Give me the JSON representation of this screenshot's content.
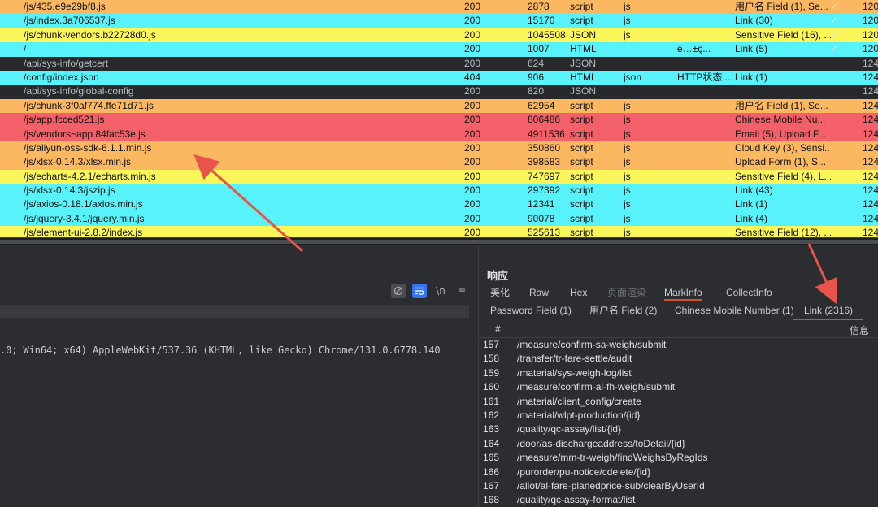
{
  "colors": {
    "orange": "#fbb860",
    "cyan": "#58f2fa",
    "yellow": "#fbf65a",
    "dark": "#27292c",
    "red": "#f46069",
    "accent": "#d0542b",
    "arrow": "#e8534a"
  },
  "traffic": {
    "rows": [
      {
        "color": "orange",
        "path": "/js/435.e9e29bf8.js",
        "status": "200",
        "size": "2878",
        "type": "script",
        "ext": "js",
        "title": "",
        "info": "用户名 Field (1), Se...",
        "check": "✓",
        "time": "120."
      },
      {
        "color": "cyan",
        "path": "/js/index.3a706537.js",
        "status": "200",
        "size": "15170",
        "type": "script",
        "ext": "js",
        "title": "",
        "info": "Link (30)",
        "check": "✓",
        "time": "120."
      },
      {
        "color": "yellow",
        "path": "/js/chunk-vendors.b22728d0.js",
        "status": "200",
        "size": "1045508",
        "type": "JSON",
        "ext": "js",
        "title": "",
        "info": "Sensitive Field (16), ...",
        "check": "✓",
        "time": "120."
      },
      {
        "color": "cyan",
        "path": "/",
        "status": "200",
        "size": "1007",
        "type": "HTML",
        "ext": "",
        "title": "é…±ç...",
        "info": "Link (5)",
        "check": "✓",
        "time": "120."
      },
      {
        "color": "dark",
        "path": "/api/sys-info/getcert",
        "status": "200",
        "size": "624",
        "type": "JSON",
        "ext": "",
        "title": "",
        "info": "",
        "check": "",
        "time": "124."
      },
      {
        "color": "cyan",
        "path": "/config/index.json",
        "status": "404",
        "size": "906",
        "type": "HTML",
        "ext": "json",
        "title": "HTTP状态 ...",
        "info": "Link (1)",
        "check": "",
        "time": "124."
      },
      {
        "color": "dark",
        "path": "/api/sys-info/global-config",
        "status": "200",
        "size": "820",
        "type": "JSON",
        "ext": "",
        "title": "",
        "info": "",
        "check": "",
        "time": "124."
      },
      {
        "color": "orange",
        "path": "/js/chunk-3f0af774.ffe71d71.js",
        "status": "200",
        "size": "62954",
        "type": "script",
        "ext": "js",
        "title": "",
        "info": "用户名 Field (1), Se...",
        "check": "",
        "time": "124."
      },
      {
        "color": "red",
        "path": "/js/app.fcced521.js",
        "status": "200",
        "size": "806486",
        "type": "script",
        "ext": "js",
        "title": "",
        "info": "Chinese Mobile Nu...",
        "check": "",
        "time": "124."
      },
      {
        "color": "red",
        "path": "/js/vendors~app.84fac53e.js",
        "status": "200",
        "size": "4911536",
        "type": "script",
        "ext": "js",
        "title": "",
        "info": "Email (5), Upload F...",
        "check": "",
        "time": "124."
      },
      {
        "color": "orange",
        "path": "/js/aliyun-oss-sdk-6.1.1.min.js",
        "status": "200",
        "size": "350860",
        "type": "script",
        "ext": "js",
        "title": "",
        "info": "Cloud Key (3), Sensi...",
        "check": "",
        "time": "124."
      },
      {
        "color": "orange",
        "path": "/js/xlsx-0.14.3/xlsx.min.js",
        "status": "200",
        "size": "398583",
        "type": "script",
        "ext": "js",
        "title": "",
        "info": "Upload Form (1), S...",
        "check": "",
        "time": "124."
      },
      {
        "color": "yellow",
        "path": "/js/echarts-4.2.1/echarts.min.js",
        "status": "200",
        "size": "747697",
        "type": "script",
        "ext": "js",
        "title": "",
        "info": "Sensitive Field (4), L...",
        "check": "",
        "time": "124."
      },
      {
        "color": "cyan",
        "path": "/js/xlsx-0.14.3/jszip.js",
        "status": "200",
        "size": "297392",
        "type": "script",
        "ext": "js",
        "title": "",
        "info": "Link (43)",
        "check": "",
        "time": "124."
      },
      {
        "color": "cyan",
        "path": "/js/axios-0.18.1/axios.min.js",
        "status": "200",
        "size": "12341",
        "type": "script",
        "ext": "js",
        "title": "",
        "info": "Link (1)",
        "check": "",
        "time": "124."
      },
      {
        "color": "cyan",
        "path": "/js/jquery-3.4.1/jquery.min.js",
        "status": "200",
        "size": "90078",
        "type": "script",
        "ext": "js",
        "title": "",
        "info": "Link (4)",
        "check": "",
        "time": "124."
      },
      {
        "color": "yellow",
        "path": "/js/element-ui-2.8.2/index.js",
        "status": "200",
        "size": "525613",
        "type": "script",
        "ext": "js",
        "title": "",
        "info": "Sensitive Field (12), ...",
        "check": "",
        "time": "124."
      }
    ]
  },
  "request": {
    "toolbar": {
      "wrap_icon": "wrap-icon",
      "newline_label": "\\n",
      "menu_icon": "≡"
    },
    "ua_text": ".0; Win64; x64) AppleWebKit/537.36 (KHTML, like Gecko) Chrome/131.0.6778.140"
  },
  "response": {
    "title": "响应",
    "tabs": [
      "美化",
      "Raw",
      "Hex",
      "页面渲染",
      "MarkInfo",
      "CollectInfo"
    ],
    "active_tab": "MarkInfo",
    "subtabs": [
      "Password Field (1)",
      "用户名 Field (2)",
      "Chinese Mobile Number (1)",
      "Link (2316)"
    ],
    "active_subtab": "Link (2316)",
    "table_headers": {
      "num": "#",
      "info": "信息"
    },
    "links": [
      {
        "num": "157",
        "url": "/measure/confirm-sa-weigh/submit"
      },
      {
        "num": "158",
        "url": "/transfer/tr-fare-settle/audit"
      },
      {
        "num": "159",
        "url": "/material/sys-weigh-log/list"
      },
      {
        "num": "160",
        "url": "/measure/confirm-al-fh-weigh/submit"
      },
      {
        "num": "161",
        "url": "/material/client_config/create"
      },
      {
        "num": "162",
        "url": "/material/wlpt-production/{id}"
      },
      {
        "num": "163",
        "url": "/quality/qc-assay/list/{id}"
      },
      {
        "num": "164",
        "url": "/door/as-dischargeaddress/toDetail/{id}"
      },
      {
        "num": "165",
        "url": "/measure/mm-tr-weigh/findWeighsByRegIds"
      },
      {
        "num": "166",
        "url": "/purorder/pu-notice/cdelete/{id}"
      },
      {
        "num": "167",
        "url": "/allot/al-fare-planedprice-sub/clearByUserId"
      },
      {
        "num": "168",
        "url": "/quality/qc-assay-format/list"
      }
    ]
  }
}
